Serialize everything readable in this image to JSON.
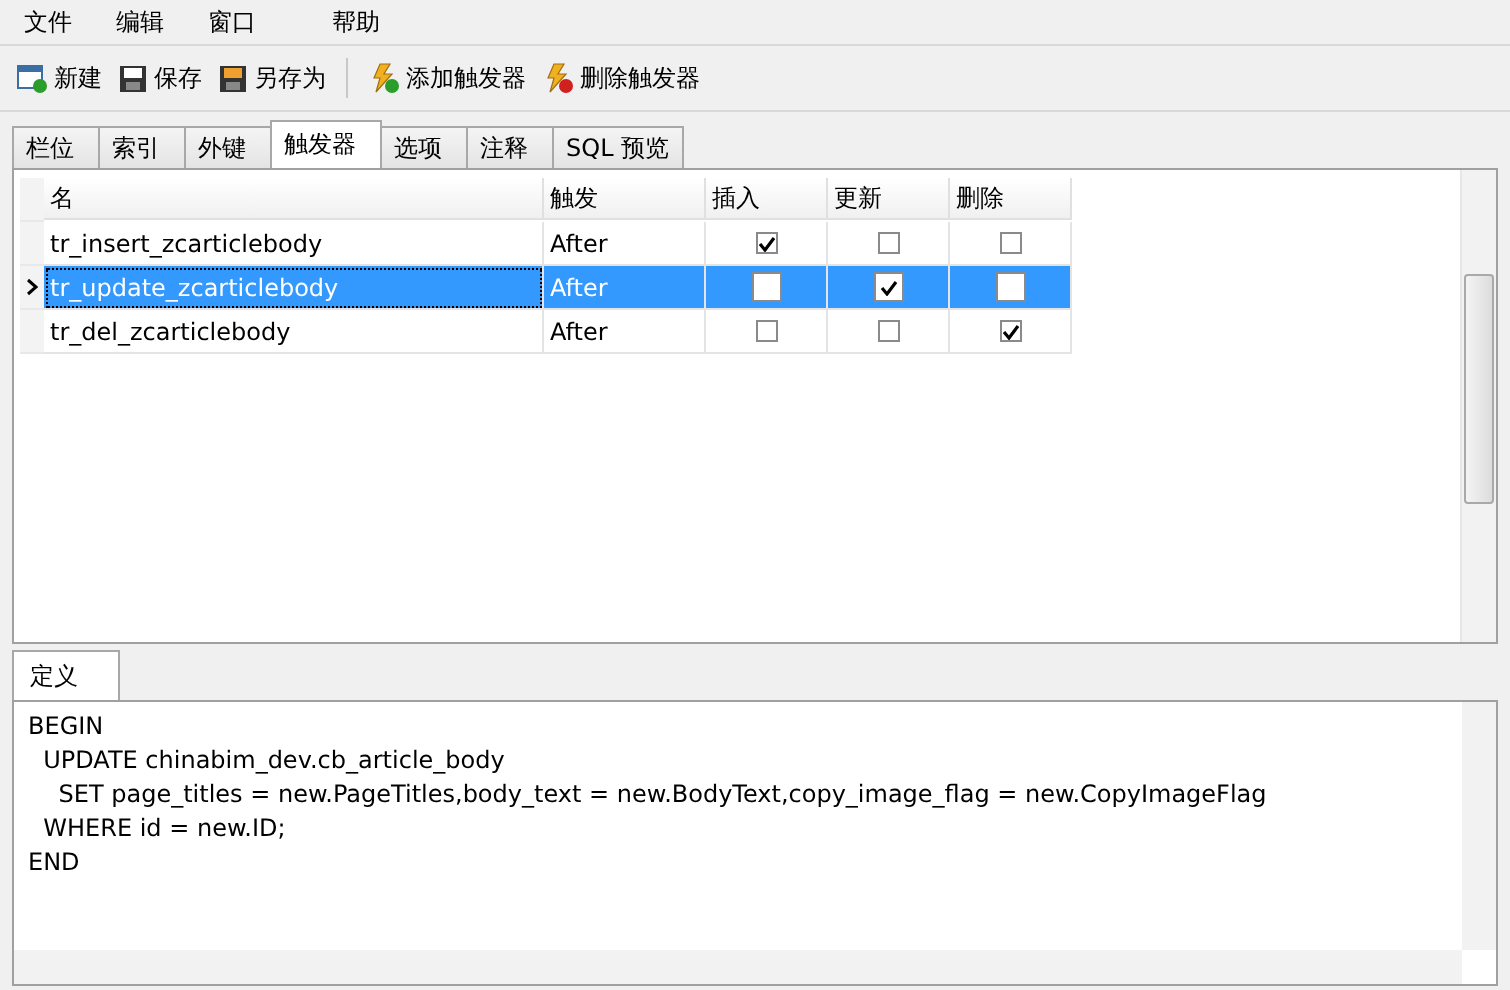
{
  "menu": [
    "文件",
    "编辑",
    "窗口",
    "帮助"
  ],
  "toolbar": [
    [
      {
        "label": "新建",
        "kind": "new"
      },
      {
        "label": "保存",
        "kind": "save"
      },
      {
        "label": "另存为",
        "kind": "saveas"
      }
    ],
    [
      {
        "label": "添加触发器",
        "kind": "add"
      },
      {
        "label": "删除触发器",
        "kind": "delete"
      }
    ]
  ],
  "tabs": [
    {
      "label": "栏位",
      "selected": false
    },
    {
      "label": "索引",
      "selected": false
    },
    {
      "label": "外键",
      "selected": false
    },
    {
      "label": "触发器",
      "selected": true
    },
    {
      "label": "选项",
      "selected": false
    },
    {
      "label": "注释",
      "selected": false
    },
    {
      "label": "SQL 预览",
      "selected": false
    }
  ],
  "table": {
    "columns": [
      "名",
      "触发",
      "插入",
      "更新",
      "删除"
    ],
    "rows": [
      {
        "name": "tr_insert_zcarticlebody",
        "timing": "After",
        "insert": true,
        "update": false,
        "delete": false,
        "selected": false
      },
      {
        "name": "tr_update_zcarticlebody",
        "timing": "After",
        "insert": false,
        "update": true,
        "delete": false,
        "selected": true
      },
      {
        "name": "tr_del_zcarticlebody",
        "timing": "After",
        "insert": false,
        "update": false,
        "delete": true,
        "selected": false
      }
    ]
  },
  "definition": {
    "tab": {
      "label": "定义",
      "selected": true
    },
    "lines": [
      "BEGIN",
      "  UPDATE chinabim_dev.cb_article_body",
      "    SET page_titles = new.PageTitles,body_text = new.BodyText,copy_image_flag = new.CopyImageFlag",
      "  WHERE id = new.ID;",
      "END"
    ]
  }
}
